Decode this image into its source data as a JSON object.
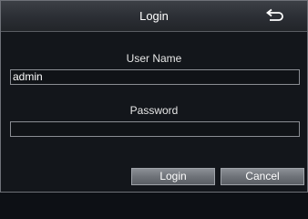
{
  "dialog": {
    "title": "Login",
    "back_icon": "return-arrow-icon",
    "user_name_label": "User Name",
    "user_name_value": "admin",
    "password_label": "Password",
    "password_value": "",
    "login_button": "Login",
    "cancel_button": "Cancel"
  }
}
